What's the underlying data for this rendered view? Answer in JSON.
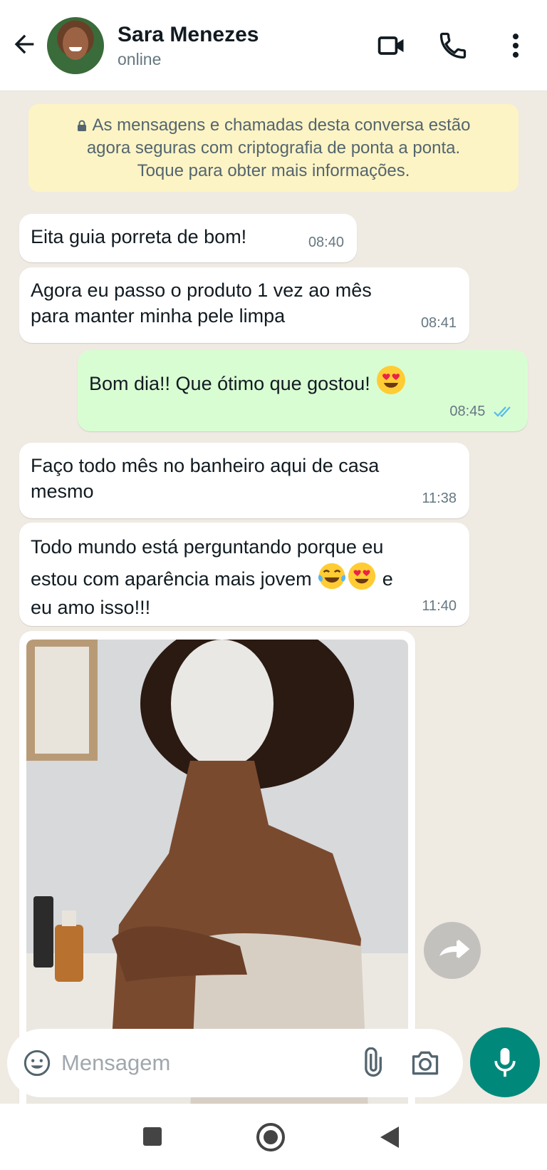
{
  "header": {
    "contact_name": "Sara Menezes",
    "status": "online"
  },
  "encryption_notice": {
    "line1": "As mensagens e chamadas desta conversa estão",
    "line2": "agora seguras com criptografia de ponta a ponta.",
    "line3": "Toque para obter mais informações."
  },
  "messages": [
    {
      "direction": "in",
      "line1": "Eita guia porreta de bom!",
      "time": "08:40"
    },
    {
      "direction": "in",
      "line1": "Agora eu passo o produto 1 vez ao mês",
      "line2": "para manter minha pele limpa",
      "time": "08:41"
    },
    {
      "direction": "out",
      "line1": "Bom dia!! Que ótimo que gostou!",
      "emoji": "heart-eyes",
      "time": "08:45",
      "read": true
    },
    {
      "direction": "in",
      "line1": "Faço todo mês no banheiro aqui de casa",
      "line2": "mesmo",
      "time": "11:38"
    },
    {
      "direction": "in",
      "line1": "Todo mundo está perguntando porque eu",
      "line2a": "estou com aparência mais jovem",
      "line2b": "e",
      "line3": "eu amo isso!!!",
      "emojis": [
        "tears-of-joy",
        "heart-eyes"
      ],
      "time": "11:40"
    },
    {
      "direction": "in",
      "type": "image",
      "description_icon": "photo"
    }
  ],
  "input": {
    "placeholder": "Mensagem"
  },
  "colors": {
    "chat_bg": "#efeae2",
    "incoming_bubble": "#ffffff",
    "outgoing_bubble": "#d9fdd3",
    "notice_bg": "#fdf4c5",
    "accent": "#00897b",
    "read_ticks": "#53bdeb"
  },
  "icons": [
    "back-arrow-icon",
    "video-call-icon",
    "phone-icon",
    "more-vert-icon",
    "lock-icon",
    "emoji-icon",
    "attach-icon",
    "camera-icon",
    "mic-icon",
    "forward-icon",
    "nav-square-icon",
    "nav-home-icon",
    "nav-back-icon"
  ]
}
